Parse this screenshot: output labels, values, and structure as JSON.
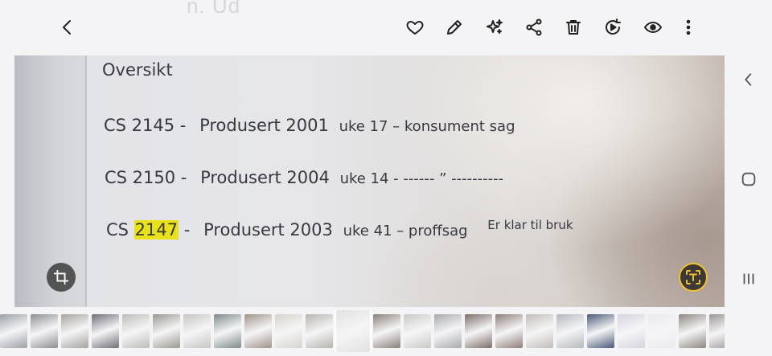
{
  "header": {
    "ghost_title": "n. Ud",
    "actions": [
      "back-icon",
      "heart-icon",
      "edit-icon",
      "sparkle-icon",
      "share-icon",
      "delete-icon",
      "remaster-icon",
      "view-icon",
      "more-icon"
    ]
  },
  "photo": {
    "heading": "Oversikt",
    "rows": [
      {
        "model": "CS 2145 -",
        "produced": "Produsert 2001",
        "week": "uke 17 – konsument sag",
        "note": ""
      },
      {
        "model": "CS 2150 -",
        "produced": "Produsert 2004",
        "week": "uke 14 -  ------ ”  ----------",
        "note": ""
      },
      {
        "model_prefix": "CS ",
        "model_highlight": "2147",
        "model_suffix": " -",
        "produced": "Produsert 2003",
        "week": "uke 41 – proffsag",
        "note": "Er klar til bruk"
      }
    ]
  },
  "thumbnails": {
    "colors": [
      "#9aa0a6",
      "#8d8f93",
      "#a7a39c",
      "#6f7077",
      "#bdbcb8",
      "#9c9890",
      "#c7c6c2",
      "#7d8a88",
      "#a0948a",
      "#d6d3cc",
      "#b8b4ad",
      "#e2e2e3",
      "#8a8178",
      "#c9cbc6",
      "#a7a9ad",
      "#7b6e66",
      "#8f7f78",
      "#c2bcb6",
      "#b5b8bd",
      "#4b5a78",
      "#d7d3de",
      "#eaeaec",
      "#8d8780",
      "#9c9793",
      "#b7b2ad",
      "#a8a6a3"
    ],
    "selected_index": 11
  }
}
